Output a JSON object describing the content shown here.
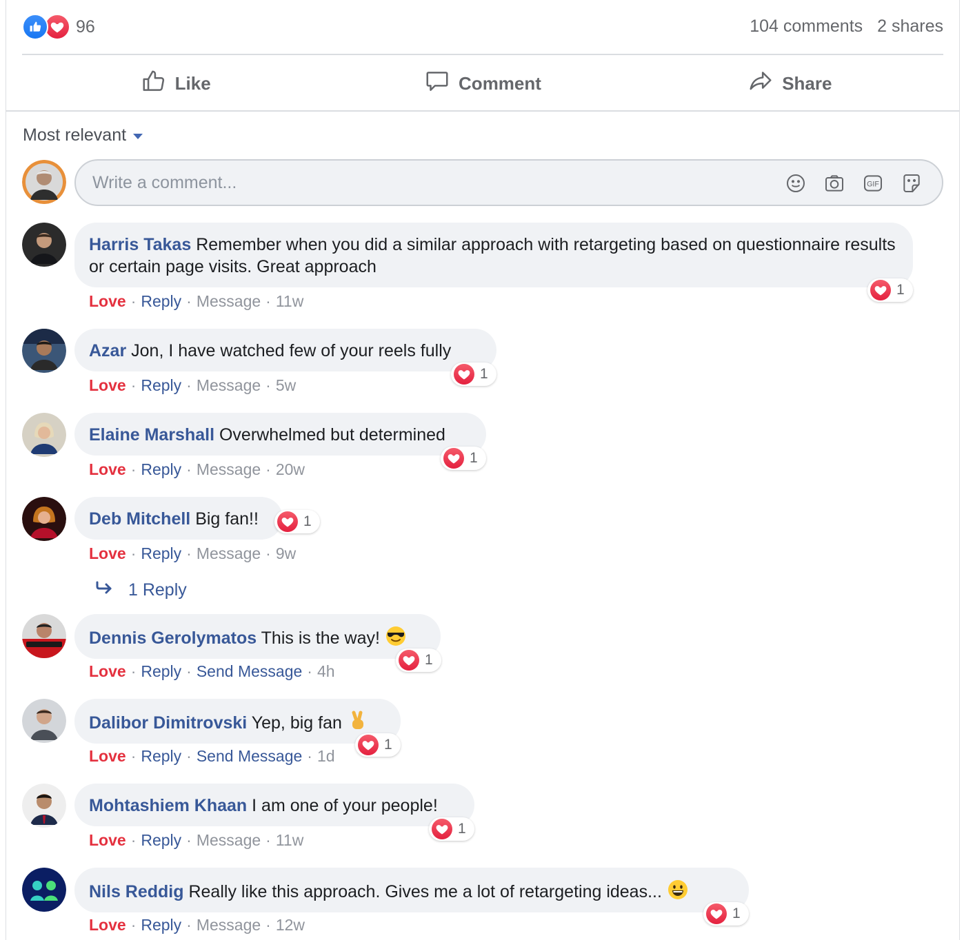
{
  "summary": {
    "reaction_count": "96",
    "comments": "104 comments",
    "shares": "2 shares"
  },
  "actions": {
    "like": "Like",
    "comment": "Comment",
    "share": "Share"
  },
  "sort": {
    "label": "Most relevant"
  },
  "composer": {
    "placeholder": "Write a comment..."
  },
  "colors": {
    "link": "#385898",
    "love": "#e4313f",
    "like_blue": "#1877f2"
  },
  "comments": [
    {
      "author": "Harris Takas",
      "text": "Remember when you did a similar approach with retargeting based on questionnaire results or certain page visits. Great approach",
      "love": "Love",
      "reply": "Reply",
      "message": "Message",
      "time": "11w",
      "reactions": "1"
    },
    {
      "author": "Azar",
      "text": "Jon, I have watched few of your reels fully",
      "love": "Love",
      "reply": "Reply",
      "message": "Message",
      "time": "5w",
      "reactions": "1"
    },
    {
      "author": "Elaine Marshall",
      "text": "Overwhelmed but determined",
      "love": "Love",
      "reply": "Reply",
      "message": "Message",
      "time": "20w",
      "reactions": "1"
    },
    {
      "author": "Deb Mitchell",
      "text": "Big fan!!",
      "love": "Love",
      "reply": "Reply",
      "message": "Message",
      "time": "9w",
      "reactions": "1",
      "replies": "1 Reply"
    },
    {
      "author": "Dennis Gerolymatos",
      "text": "This is the way!",
      "emoji": "sunglasses-emoji",
      "love": "Love",
      "reply": "Reply",
      "message": "Send Message",
      "time": "4h",
      "reactions": "1"
    },
    {
      "author": "Dalibor Dimitrovski",
      "text": "Yep, big fan",
      "emoji": "victory-hand-emoji",
      "love": "Love",
      "reply": "Reply",
      "message": "Send Message",
      "time": "1d",
      "reactions": "1"
    },
    {
      "author": "Mohtashiem Khaan",
      "text": "I am one of your people!",
      "love": "Love",
      "reply": "Reply",
      "message": "Message",
      "time": "11w",
      "reactions": "1"
    },
    {
      "author": "Nils Reddig",
      "text": "Really like this approach. Gives me a lot of retargeting ideas...",
      "emoji": "grinning-emoji",
      "love": "Love",
      "reply": "Reply",
      "message": "Message",
      "time": "12w",
      "reactions": "1"
    }
  ]
}
